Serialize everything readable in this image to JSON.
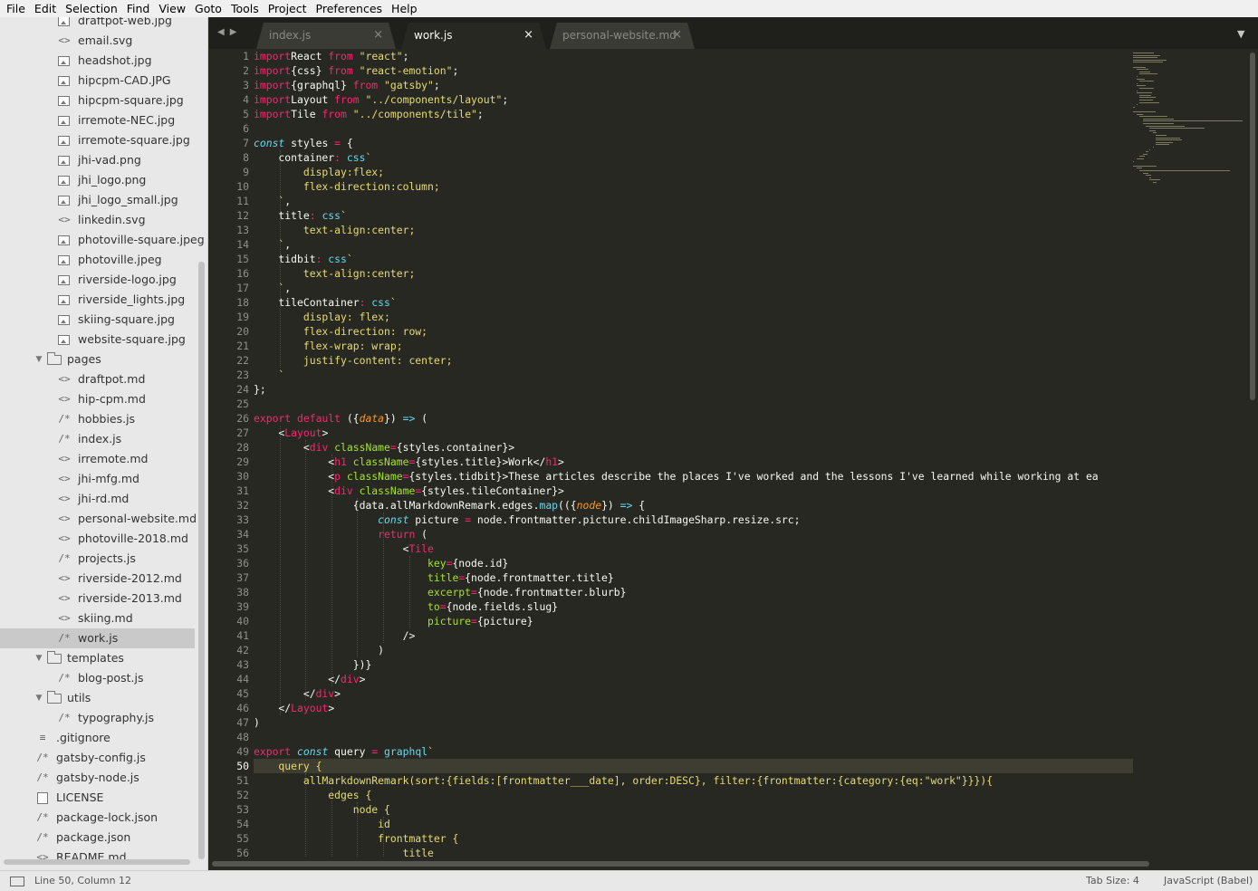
{
  "menu": [
    "File",
    "Edit",
    "Selection",
    "Find",
    "View",
    "Goto",
    "Tools",
    "Project",
    "Preferences",
    "Help"
  ],
  "sidebar": {
    "items": [
      {
        "label": "draftpot-web.jpg",
        "icon": "image-file-icon",
        "level": 2
      },
      {
        "label": "email.svg",
        "icon": "code-file-icon",
        "level": 2
      },
      {
        "label": "headshot.jpg",
        "icon": "image-file-icon",
        "level": 2
      },
      {
        "label": "hipcpm-CAD.JPG",
        "icon": "image-file-icon",
        "level": 2
      },
      {
        "label": "hipcpm-square.jpg",
        "icon": "image-file-icon",
        "level": 2
      },
      {
        "label": "irremote-NEC.jpg",
        "icon": "image-file-icon",
        "level": 2
      },
      {
        "label": "irremote-square.jpg",
        "icon": "image-file-icon",
        "level": 2
      },
      {
        "label": "jhi-vad.png",
        "icon": "image-file-icon",
        "level": 2
      },
      {
        "label": "jhi_logo.png",
        "icon": "image-file-icon",
        "level": 2
      },
      {
        "label": "jhi_logo_small.jpg",
        "icon": "image-file-icon",
        "level": 2
      },
      {
        "label": "linkedin.svg",
        "icon": "code-file-icon",
        "level": 2
      },
      {
        "label": "photoville-square.jpeg",
        "icon": "image-file-icon",
        "level": 2
      },
      {
        "label": "photoville.jpeg",
        "icon": "image-file-icon",
        "level": 2
      },
      {
        "label": "riverside-logo.jpg",
        "icon": "image-file-icon",
        "level": 2
      },
      {
        "label": "riverside_lights.jpg",
        "icon": "image-file-icon",
        "level": 2
      },
      {
        "label": "skiing-square.jpg",
        "icon": "image-file-icon",
        "level": 2
      },
      {
        "label": "website-square.jpg",
        "icon": "image-file-icon",
        "level": 2
      },
      {
        "label": "pages",
        "icon": "folder-icon",
        "level": 1
      },
      {
        "label": "draftpot.md",
        "icon": "code-file-icon",
        "level": 2
      },
      {
        "label": "hip-cpm.md",
        "icon": "code-file-icon",
        "level": 2
      },
      {
        "label": "hobbies.js",
        "icon": "js-file-icon",
        "level": 2
      },
      {
        "label": "index.js",
        "icon": "js-file-icon",
        "level": 2
      },
      {
        "label": "irremote.md",
        "icon": "code-file-icon",
        "level": 2
      },
      {
        "label": "jhi-mfg.md",
        "icon": "code-file-icon",
        "level": 2
      },
      {
        "label": "jhi-rd.md",
        "icon": "code-file-icon",
        "level": 2
      },
      {
        "label": "personal-website.md",
        "icon": "code-file-icon",
        "level": 2
      },
      {
        "label": "photoville-2018.md",
        "icon": "code-file-icon",
        "level": 2
      },
      {
        "label": "projects.js",
        "icon": "js-file-icon",
        "level": 2
      },
      {
        "label": "riverside-2012.md",
        "icon": "code-file-icon",
        "level": 2
      },
      {
        "label": "riverside-2013.md",
        "icon": "code-file-icon",
        "level": 2
      },
      {
        "label": "skiing.md",
        "icon": "code-file-icon",
        "level": 2
      },
      {
        "label": "work.js",
        "icon": "js-file-icon",
        "level": 2,
        "selected": true
      },
      {
        "label": "templates",
        "icon": "folder-icon",
        "level": 1
      },
      {
        "label": "blog-post.js",
        "icon": "js-file-icon",
        "level": 2
      },
      {
        "label": "utils",
        "icon": "folder-icon",
        "level": 1
      },
      {
        "label": "typography.js",
        "icon": "js-file-icon",
        "level": 2
      },
      {
        "label": ".gitignore",
        "icon": "text-file-icon",
        "level": 0
      },
      {
        "label": "gatsby-config.js",
        "icon": "js-file-icon",
        "level": 0
      },
      {
        "label": "gatsby-node.js",
        "icon": "js-file-icon",
        "level": 0
      },
      {
        "label": "LICENSE",
        "icon": "blank-file-icon",
        "level": 0
      },
      {
        "label": "package-lock.json",
        "icon": "js-file-icon",
        "level": 0
      },
      {
        "label": "package.json",
        "icon": "js-file-icon",
        "level": 0
      },
      {
        "label": "README.md",
        "icon": "code-file-icon",
        "level": 0
      }
    ]
  },
  "tabs": [
    {
      "label": "index.js",
      "active": false
    },
    {
      "label": "work.js",
      "active": true
    },
    {
      "label": "personal-website.md",
      "active": false
    }
  ],
  "tab_close": "×",
  "editor": {
    "current_line": 50,
    "lines": [
      [
        [
          "k",
          "import"
        ],
        [
          "",
          "React "
        ],
        [
          "k",
          "from"
        ],
        [
          "",
          ""
        ],
        [
          "s",
          " \"react\""
        ],
        [
          "",
          ";"
        ]
      ],
      [
        [
          "k",
          "import"
        ],
        [
          "",
          "{css} "
        ],
        [
          "k",
          "from"
        ],
        [
          "s",
          " \"react-emotion\""
        ],
        [
          "",
          ";"
        ]
      ],
      [
        [
          "k",
          "import"
        ],
        [
          "",
          "{graphql} "
        ],
        [
          "k",
          "from"
        ],
        [
          "s",
          " \"gatsby\""
        ],
        [
          "",
          ";"
        ]
      ],
      [
        [
          "k",
          "import"
        ],
        [
          "",
          "Layout "
        ],
        [
          "k",
          "from"
        ],
        [
          "s",
          " \"../components/layout\""
        ],
        [
          "",
          ";"
        ]
      ],
      [
        [
          "k",
          "import"
        ],
        [
          "",
          "Tile "
        ],
        [
          "k",
          "from"
        ],
        [
          "s",
          " \"../components/tile\""
        ],
        [
          "",
          ";"
        ]
      ],
      [],
      [
        [
          "st",
          "const"
        ],
        [
          "",
          " styles "
        ],
        [
          "k",
          "="
        ],
        [
          "",
          " {"
        ]
      ],
      [
        [
          "",
          "    container"
        ],
        [
          "k",
          ":"
        ],
        [
          "f",
          " css"
        ],
        [
          "s",
          "`"
        ]
      ],
      [
        [
          "s",
          "        display:flex;"
        ]
      ],
      [
        [
          "s",
          "        flex-direction:column;"
        ]
      ],
      [
        [
          "s",
          "    `"
        ],
        [
          "",
          ","
        ]
      ],
      [
        [
          "",
          "    title"
        ],
        [
          "k",
          ":"
        ],
        [
          "f",
          " css"
        ],
        [
          "s",
          "`"
        ]
      ],
      [
        [
          "s",
          "        text-align:center;"
        ]
      ],
      [
        [
          "s",
          "    `"
        ],
        [
          "",
          ","
        ]
      ],
      [
        [
          "",
          "    tidbit"
        ],
        [
          "k",
          ":"
        ],
        [
          "f",
          " css"
        ],
        [
          "s",
          "`"
        ]
      ],
      [
        [
          "s",
          "        text-align:center;"
        ]
      ],
      [
        [
          "s",
          "    `"
        ],
        [
          "",
          ","
        ]
      ],
      [
        [
          "",
          "    tileContainer"
        ],
        [
          "k",
          ":"
        ],
        [
          "f",
          " css"
        ],
        [
          "s",
          "`"
        ]
      ],
      [
        [
          "s",
          "        display: flex;"
        ]
      ],
      [
        [
          "s",
          "        flex-direction: row;"
        ]
      ],
      [
        [
          "s",
          "        flex-wrap: wrap;"
        ]
      ],
      [
        [
          "s",
          "        justify-content: center;"
        ]
      ],
      [
        [
          "s",
          "    `"
        ]
      ],
      [
        [
          "",
          "};"
        ]
      ],
      [],
      [
        [
          "k",
          "export"
        ],
        [
          "k",
          " default"
        ],
        [
          "",
          " ({"
        ],
        [
          "p",
          "data"
        ],
        [
          "",
          "}) "
        ],
        [
          "st",
          "=>"
        ],
        [
          "",
          " ("
        ]
      ],
      [
        [
          "",
          "    <"
        ],
        [
          "g",
          "Layout"
        ],
        [
          "",
          ">"
        ]
      ],
      [
        [
          "",
          "        <"
        ],
        [
          "g",
          "div"
        ],
        [
          "a",
          " className"
        ],
        [
          "k",
          "="
        ],
        [
          "",
          "{styles.container}>"
        ]
      ],
      [
        [
          "",
          "            <"
        ],
        [
          "g",
          "h1"
        ],
        [
          "a",
          " className"
        ],
        [
          "k",
          "="
        ],
        [
          "",
          "{styles.title}>Work</"
        ],
        [
          "g",
          "h1"
        ],
        [
          "",
          ">"
        ]
      ],
      [
        [
          "",
          "            <"
        ],
        [
          "g",
          "p"
        ],
        [
          "a",
          " className"
        ],
        [
          "k",
          "="
        ],
        [
          "",
          "{styles.tidbit}>These articles describe the places I've worked and the lessons I've learned while working at ea"
        ]
      ],
      [
        [
          "",
          "            <"
        ],
        [
          "g",
          "div"
        ],
        [
          "a",
          " className"
        ],
        [
          "k",
          "="
        ],
        [
          "",
          "{styles.tileContainer}>"
        ]
      ],
      [
        [
          "",
          "                {data.allMarkdownRemark.edges."
        ],
        [
          "f",
          "map"
        ],
        [
          "",
          "(({"
        ],
        [
          "p",
          "node"
        ],
        [
          "",
          "}) "
        ],
        [
          "st",
          "=>"
        ],
        [
          "",
          " {"
        ]
      ],
      [
        [
          "st",
          "                    const"
        ],
        [
          "",
          " picture "
        ],
        [
          "k",
          "="
        ],
        [
          "",
          " node.frontmatter.picture.childImageSharp.resize.src;"
        ]
      ],
      [
        [
          "k",
          "                    return"
        ],
        [
          "",
          " ("
        ]
      ],
      [
        [
          "",
          "                        <"
        ],
        [
          "g",
          "Tile"
        ]
      ],
      [
        [
          "a",
          "                            key"
        ],
        [
          "k",
          "="
        ],
        [
          "",
          "{node.id}"
        ]
      ],
      [
        [
          "a",
          "                            title"
        ],
        [
          "k",
          "="
        ],
        [
          "",
          "{node.frontmatter.title}"
        ]
      ],
      [
        [
          "a",
          "                            excerpt"
        ],
        [
          "k",
          "="
        ],
        [
          "",
          "{node.frontmatter.blurb}"
        ]
      ],
      [
        [
          "a",
          "                            to"
        ],
        [
          "k",
          "="
        ],
        [
          "",
          "{node.fields.slug}"
        ]
      ],
      [
        [
          "a",
          "                            picture"
        ],
        [
          "k",
          "="
        ],
        [
          "",
          "{picture}"
        ]
      ],
      [
        [
          "",
          "                        />"
        ]
      ],
      [
        [
          "",
          "                    )"
        ]
      ],
      [
        [
          "",
          "                })}"
        ]
      ],
      [
        [
          "",
          "            </"
        ],
        [
          "g",
          "div"
        ],
        [
          "",
          ">"
        ]
      ],
      [
        [
          "",
          "        </"
        ],
        [
          "g",
          "div"
        ],
        [
          "",
          ">"
        ]
      ],
      [
        [
          "",
          "    </"
        ],
        [
          "g",
          "Layout"
        ],
        [
          "",
          ">"
        ]
      ],
      [
        [
          "",
          ")"
        ]
      ],
      [],
      [
        [
          "k",
          "export"
        ],
        [
          "st",
          " const"
        ],
        [
          "",
          " query "
        ],
        [
          "k",
          "="
        ],
        [
          "f",
          " graphql"
        ],
        [
          "s",
          "`"
        ]
      ],
      [
        [
          "s",
          "    query {"
        ]
      ],
      [
        [
          "s",
          "        allMarkdownRemark(sort:{fields:[frontmatter___date], order:DESC}, filter:{frontmatter:{category:{eq:\"work\"}}}){"
        ]
      ],
      [
        [
          "s",
          "            edges {"
        ]
      ],
      [
        [
          "s",
          "                node {"
        ]
      ],
      [
        [
          "s",
          "                    id"
        ]
      ],
      [
        [
          "s",
          "                    frontmatter {"
        ]
      ],
      [
        [
          "s",
          "                        title"
        ]
      ]
    ]
  },
  "status": {
    "position": "Line 50, Column 12",
    "tab_size": "Tab Size: 4",
    "syntax": "JavaScript (Babel)"
  }
}
